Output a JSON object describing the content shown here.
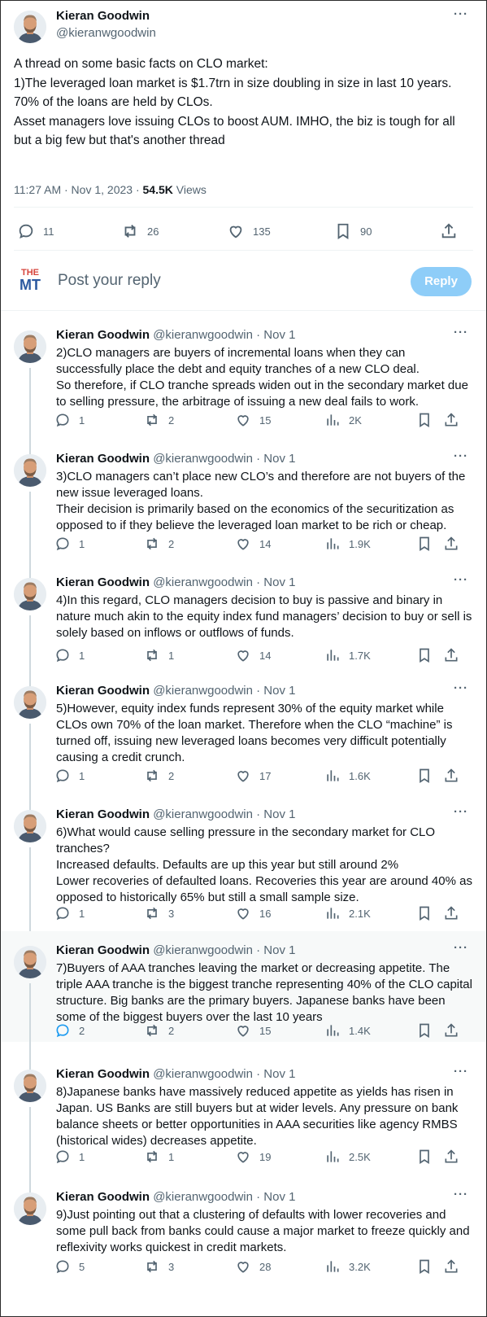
{
  "main_tweet": {
    "author_name": "Kieran Goodwin",
    "author_handle": "@kieranwgoodwin",
    "text": "A thread on some basic facts on CLO market:\n1)The leveraged loan market is $1.7trn in size doubling in size in last 10 years.\n70% of the loans are held by CLOs.\nAsset managers love issuing CLOs to boost AUM. IMHO, the biz is tough for all but a big few but that's another thread",
    "timestamp": "11:27 AM · Nov 1, 2023 · ",
    "views_count": "54.5K",
    "views_label": " Views",
    "replies": "11",
    "reposts": "26",
    "likes": "135",
    "bookmarks": "90"
  },
  "reply_box": {
    "placeholder": "Post your reply",
    "button_label": "Reply",
    "logo_top": "THE",
    "logo_bottom": "MT"
  },
  "thread": [
    {
      "name": "Kieran Goodwin",
      "handle": "@kieranwgoodwin · Nov 1",
      "text": "2)CLO managers are buyers of incremental loans when they can successfully place the debt and equity tranches of a new CLO deal.\nSo therefore, if CLO tranche spreads widen out in the secondary market due to selling pressure, the arbitrage of issuing a new deal fails to work.",
      "replies": "1",
      "reposts": "2",
      "likes": "15",
      "views": "2K"
    },
    {
      "name": "Kieran Goodwin",
      "handle": "@kieranwgoodwin · Nov 1",
      "text": "3)CLO managers can’t place new CLO’s and therefore are not buyers of the new issue leveraged loans.\nTheir decision is primarily based on the economics of the securitization as opposed to if they believe the leveraged loan market to be rich or cheap.",
      "replies": "1",
      "reposts": "2",
      "likes": "14",
      "views": "1.9K"
    },
    {
      "name": "Kieran Goodwin",
      "handle": "@kieranwgoodwin · Nov 1",
      "text": "4)In this regard, CLO managers decision to buy is passive and binary in nature much akin to the equity index fund managers’ decision to buy or sell is solely based on inflows or outflows of funds.",
      "replies": "1",
      "reposts": "1",
      "likes": "14",
      "views": "1.7K"
    },
    {
      "name": "Kieran Goodwin",
      "handle": "@kieranwgoodwin · Nov 1",
      "text": "5)However, equity index funds represent 30% of the equity market while CLOs own 70% of the loan market. Therefore when the CLO “machine” is turned off, issuing new leveraged loans becomes very difficult potentially causing a credit crunch.",
      "replies": "1",
      "reposts": "2",
      "likes": "17",
      "views": "1.6K"
    },
    {
      "name": "Kieran Goodwin",
      "handle": "@kieranwgoodwin · Nov 1",
      "text": "6)What would cause selling pressure in the secondary market for CLO tranches?\nIncreased defaults. Defaults are up this year but still around 2%\nLower recoveries of defaulted loans. Recoveries this year are around 40% as opposed to historically 65% but still a small sample size.",
      "replies": "1",
      "reposts": "3",
      "likes": "16",
      "views": "2.1K"
    },
    {
      "name": "Kieran Goodwin",
      "handle": "@kieranwgoodwin · Nov 1",
      "text": "7)Buyers of AAA tranches leaving the market or decreasing appetite. The triple AAA tranche is the biggest tranche representing 40% of the CLO capital structure. Big banks are the primary buyers. Japanese banks have been some of the biggest buyers over the last 10 years",
      "replies": "2",
      "reposts": "2",
      "likes": "15",
      "views": "1.4K"
    },
    {
      "name": "Kieran Goodwin",
      "handle": "@kieranwgoodwin · Nov 1",
      "text": "8)Japanese banks have massively reduced appetite as yields has risen in Japan. US Banks are still buyers but at wider levels. Any pressure on bank balance sheets or better opportunities in AAA securities like agency RMBS (historical wides) decreases appetite.",
      "replies": "1",
      "reposts": "1",
      "likes": "19",
      "views": "2.5K"
    },
    {
      "name": "Kieran Goodwin",
      "handle": "@kieranwgoodwin · Nov 1",
      "text": "9)Just pointing out that a clustering of defaults with lower recoveries and some pull back from banks could cause a major market to freeze quickly and reflexivity works quickest in credit markets.",
      "replies": "5",
      "reposts": "3",
      "likes": "28",
      "views": "3.2K"
    }
  ],
  "colors": {
    "accent": "#1d9bf0",
    "reply_button_disabled": "#8ecdf8",
    "muted_text": "#536471",
    "logo_red": "#d6453d",
    "logo_blue": "#2d5aa0"
  },
  "icons": [
    "avatar",
    "more-icon",
    "reply-icon",
    "repost-icon",
    "like-icon",
    "views-icon",
    "bookmark-icon",
    "share-icon"
  ]
}
